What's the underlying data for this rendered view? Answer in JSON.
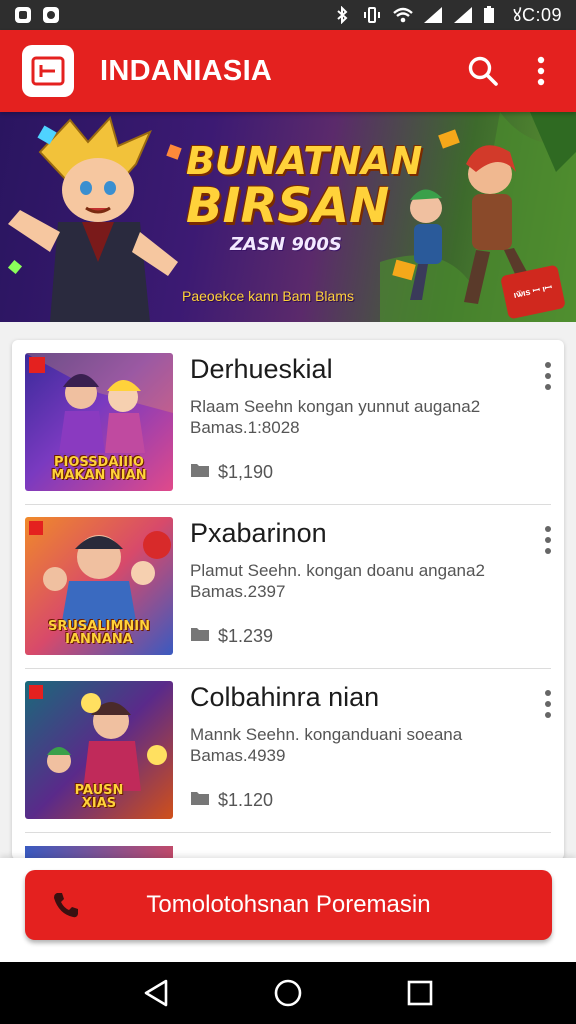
{
  "status_bar": {
    "time": "ꙋC:09",
    "icons": [
      "app-notification-icon",
      "app-notification-icon",
      "bluetooth-icon",
      "vibrate-icon",
      "wifi-icon",
      "signal-icon",
      "signal-icon",
      "battery-icon"
    ]
  },
  "app_bar": {
    "title": "INDANIASIA",
    "logo_icon": "app-logo-icon",
    "actions": [
      "search-icon",
      "more-vert-icon"
    ]
  },
  "banner": {
    "title_line1": "BUNATNAN",
    "title_line2": "BIRSAN",
    "title_line3": "ZASN 900S",
    "subtitle": "Paeoekce kann Bam Blams",
    "badge": "ıѿıѕ ꟷ ıꟷ"
  },
  "items": [
    {
      "title": "Derhueskial",
      "desc_line1": "Rlaam Seehn kongan yunnut augana2",
      "desc_line2": "Bamas.1:8028",
      "price": "$1,190",
      "thumb_label_line1": "PIOSSDAIIIO",
      "thumb_label_line2": "MAKAN NIAN"
    },
    {
      "title": "Pxabarinon",
      "desc_line1": "Plamut Seehn. kongan doanu angana2",
      "desc_line2": "Bamas.2397",
      "price": "$1.239",
      "thumb_label_line1": "SRUSALIMNIN",
      "thumb_label_line2": "IANNANA"
    },
    {
      "title": "Colbahinra nian",
      "desc_line1": "Mannk Seehn. konganduani soeana",
      "desc_line2": "Bamas.4939",
      "price": "$1.120",
      "thumb_label_line1": "PAUSN",
      "thumb_label_line2": "XIAS"
    }
  ],
  "primary_action": {
    "label": "Tomolotohsnan Poremasin",
    "icon": "phone-icon"
  },
  "nav_bar": {
    "buttons": [
      "back-icon",
      "home-icon",
      "recents-icon"
    ]
  },
  "colors": {
    "accent": "#e4211f",
    "status_bar": "#2e2e2e",
    "nav_bar": "#000000"
  }
}
